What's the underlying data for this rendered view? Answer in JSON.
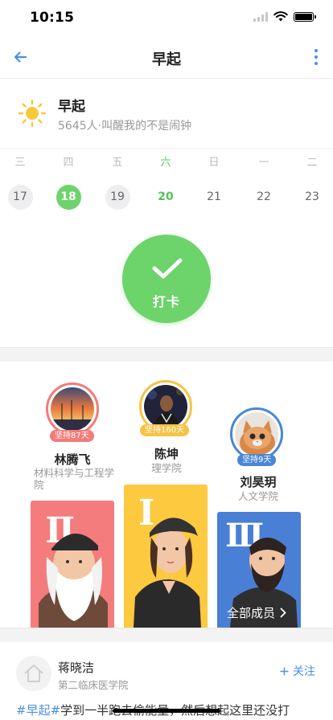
{
  "status": {
    "time": "10:15"
  },
  "nav": {
    "title": "早起"
  },
  "group": {
    "name": "早起",
    "subtitle": "5645人·叫醒我的不是闹钟"
  },
  "week": [
    {
      "day": "三",
      "date": "17",
      "style": "grey"
    },
    {
      "day": "四",
      "date": "18",
      "style": "green"
    },
    {
      "day": "五",
      "date": "19",
      "style": "grey"
    },
    {
      "day": "六",
      "date": "20",
      "style": "today"
    },
    {
      "day": "日",
      "date": "21",
      "style": "plain"
    },
    {
      "day": "一",
      "date": "22",
      "style": "plain"
    },
    {
      "day": "二",
      "date": "23",
      "style": "plain"
    }
  ],
  "checkin": {
    "label": "打卡"
  },
  "ranking": [
    {
      "rank": "II",
      "name": "林腾飞",
      "school": "材料科学与工程学院",
      "streak": "坚持87天",
      "ring_color": "#f47a7a",
      "card_color": "#f47c7c"
    },
    {
      "rank": "I",
      "name": "陈坤",
      "school": "理学院",
      "streak": "坚持160天",
      "ring_color": "#f6c344",
      "card_color": "#fcc93f"
    },
    {
      "rank": "III",
      "name": "刘昊玥",
      "school": "人文学院",
      "streak": "坚持9天",
      "ring_color": "#4a86d8",
      "card_color": "#4a7fd6"
    }
  ],
  "members": {
    "label": "全部成员"
  },
  "post": {
    "name": "蒋晓洁",
    "school": "第二临床医学院",
    "follow_label": "关注",
    "tag": "#早起#",
    "text": "学到一半跑去偷能量，然后想起这里还没打"
  },
  "colors": {
    "accent": "#4a90e2",
    "green": "#6dd36b"
  }
}
